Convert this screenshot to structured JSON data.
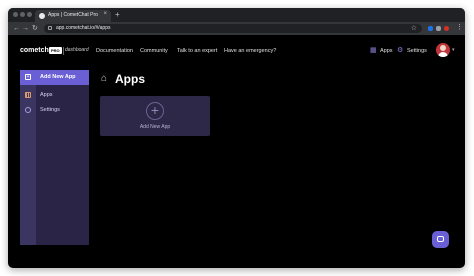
{
  "browser": {
    "tab_title": "Apps | CometChat Pro",
    "tab_close": "×",
    "new_tab": "+",
    "url": "app.cometchat.io/#/apps"
  },
  "header": {
    "logo": "cometchat",
    "pro_badge": "PRO",
    "dashboard_label": "dashboard",
    "nav": [
      "Documentation",
      "Community",
      "Talk to an expert",
      "Have an emergency?"
    ],
    "apps_label": "Apps",
    "settings_label": "Settings"
  },
  "sidebar": {
    "add_new_label": "Add New App",
    "items": [
      {
        "label": "Apps",
        "icon": "grid-icon"
      },
      {
        "label": "Settings",
        "icon": "gear-icon"
      }
    ]
  },
  "main": {
    "title": "Apps",
    "card_label": "Add New App"
  },
  "colors": {
    "accent": "#6a5fd4",
    "sidebar": "#2a2546",
    "card": "#2d2848"
  }
}
